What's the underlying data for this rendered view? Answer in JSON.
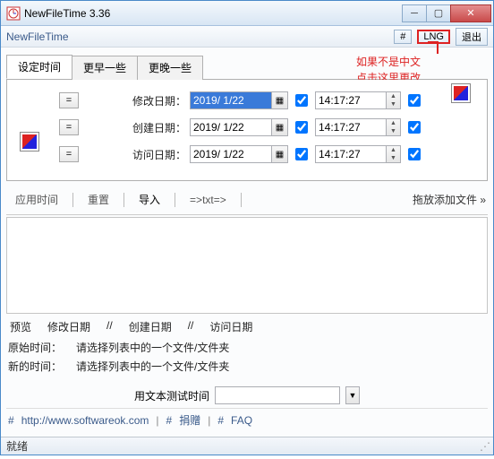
{
  "title": "NewFileTime 3.36",
  "menubar": {
    "appname": "NewFileTime",
    "hash": "#",
    "lng": "LNG",
    "exit": "退出"
  },
  "annotation": {
    "line1": "如果不是中文",
    "line2": "点击这里更改"
  },
  "tabs": {
    "t0": "设定时间",
    "t1": "更早一些",
    "t2": "更晚一些"
  },
  "rows": {
    "eq": "=",
    "mod": {
      "label": "修改日期：",
      "date": "2019/ 1/22",
      "time": "14:17:27"
    },
    "cre": {
      "label": "创建日期：",
      "date": "2019/ 1/22",
      "time": "14:17:27"
    },
    "acc": {
      "label": "访问日期：",
      "date": "2019/ 1/22",
      "time": "14:17:27"
    }
  },
  "toolbar": {
    "apply": "应用时间",
    "reset": "重置",
    "import": "导入",
    "totxt": "=>txt=>",
    "droplabel": "拖放添加文件",
    "chev": "»"
  },
  "headers": {
    "preview": "预览",
    "mod": "修改日期",
    "cre": "创建日期",
    "acc": "访问日期",
    "slash": "//"
  },
  "info": {
    "orig": "原始时间：",
    "new": "新的时间：",
    "hint": "请选择列表中的一个文件/文件夹"
  },
  "texttest": {
    "label": "用文本测试时间"
  },
  "footer": {
    "url": "http://www.softwareok.com",
    "donate": "捐赠",
    "faq": "FAQ",
    "hash": "#"
  },
  "status": "就绪"
}
